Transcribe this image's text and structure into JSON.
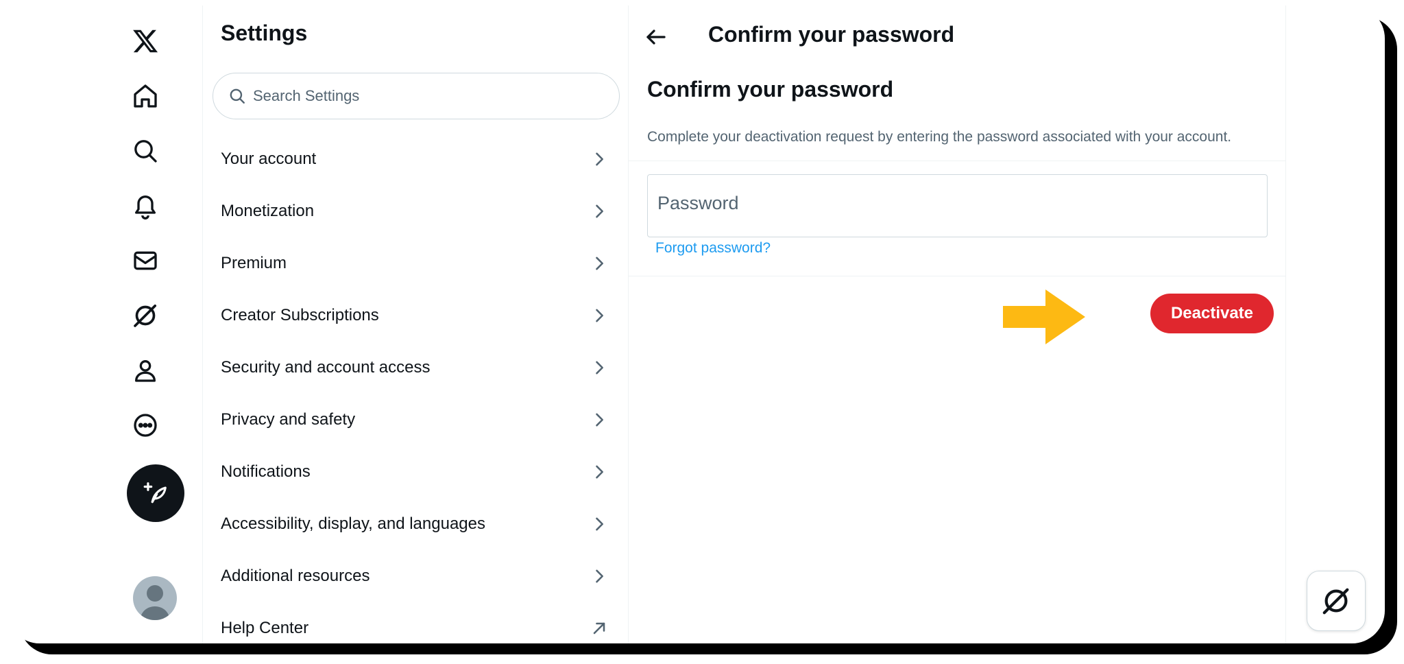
{
  "nav": {
    "icons": [
      "x-logo-icon",
      "home-icon",
      "search-icon",
      "bell-icon",
      "mail-icon",
      "grok-icon",
      "profile-icon",
      "more-icon"
    ],
    "compose_icon": "compose-feather-icon",
    "avatar_icon": "default-avatar-icon"
  },
  "settings": {
    "title": "Settings",
    "search_placeholder": "Search Settings",
    "items": [
      {
        "label": "Your account",
        "icon": "chevron-right-icon"
      },
      {
        "label": "Monetization",
        "icon": "chevron-right-icon"
      },
      {
        "label": "Premium",
        "icon": "chevron-right-icon"
      },
      {
        "label": "Creator Subscriptions",
        "icon": "chevron-right-icon"
      },
      {
        "label": "Security and account access",
        "icon": "chevron-right-icon"
      },
      {
        "label": "Privacy and safety",
        "icon": "chevron-right-icon"
      },
      {
        "label": "Notifications",
        "icon": "chevron-right-icon"
      },
      {
        "label": "Accessibility, display, and languages",
        "icon": "chevron-right-icon"
      },
      {
        "label": "Additional resources",
        "icon": "chevron-right-icon"
      },
      {
        "label": "Help Center",
        "icon": "external-link-icon"
      }
    ]
  },
  "main": {
    "header_title": "Confirm your password",
    "heading": "Confirm your password",
    "description": "Complete your deactivation request by entering the password associated with your account.",
    "password_placeholder": "Password",
    "forgot_link": "Forgot password?",
    "deactivate_label": "Deactivate"
  },
  "colors": {
    "deactivate": "#e0272e",
    "link": "#1d9bf0",
    "annotation_arrow": "#fdb913",
    "text": "#0f1419",
    "muted": "#536471"
  }
}
